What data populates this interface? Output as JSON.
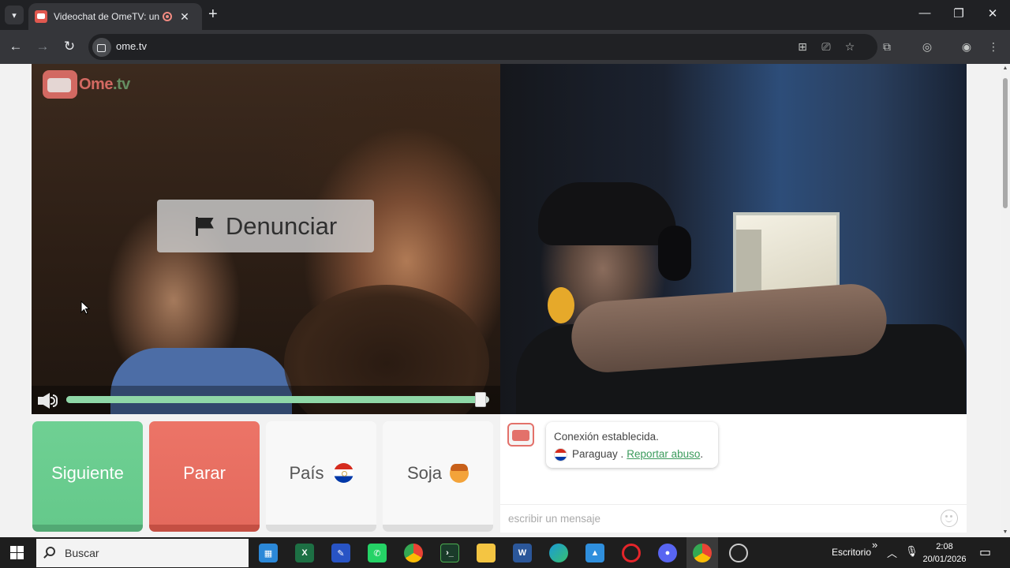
{
  "browser": {
    "tab_title": "Videochat de OmeTV: una a",
    "new_tab": "+",
    "url": "ome.tv",
    "window_controls": {
      "minimize": "—",
      "restore": "❐",
      "close": "✕"
    }
  },
  "video": {
    "logo_text_1": "Ome",
    "logo_text_2": ".tv",
    "report_label": "Denunciar",
    "volume_level": 0.98
  },
  "controls": {
    "next_label": "Siguiente",
    "stop_label": "Parar",
    "country_label": "País",
    "gender_label": "Soja"
  },
  "chat": {
    "status": "Conexión establecida.",
    "country": "Paraguay .",
    "report_link": "Reportar abuso",
    "period": ".",
    "input_placeholder": "escribir un mensaje"
  },
  "taskbar": {
    "search_placeholder": "Buscar",
    "desktop_label": "Escritorio",
    "chevron": "»",
    "time": "2:08",
    "date": "20/01/2026",
    "apps": [
      "store",
      "excel",
      "paint",
      "whatsapp",
      "chrome",
      "terminal",
      "explorer",
      "word",
      "edge",
      "photos",
      "opera",
      "discord",
      "chrome-active",
      "speedtest"
    ]
  },
  "colors": {
    "next": "#6fd093",
    "stop": "#ec7467",
    "link": "#3b9b5c",
    "brand": "#e3716a"
  }
}
